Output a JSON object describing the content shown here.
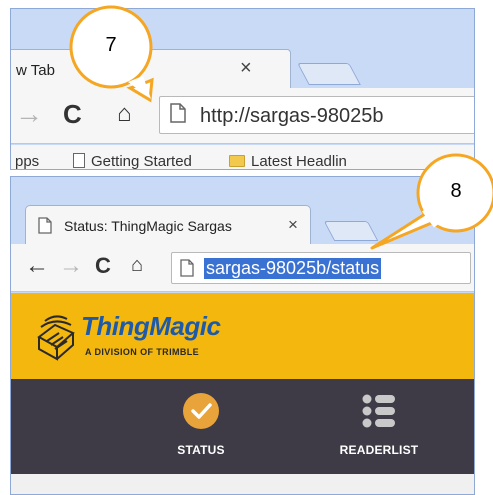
{
  "panel1": {
    "tab": {
      "title": "w Tab",
      "close": "×"
    },
    "toolbar": {
      "forward": "→",
      "reload": "C",
      "home": "⌂"
    },
    "omnibox": {
      "url": "http://sargas-98025b"
    },
    "bookmarks": [
      "pps",
      "Getting Started",
      "Latest Headlin"
    ]
  },
  "panel2": {
    "tab": {
      "title": "Status: ThingMagic Sargas",
      "close": "×"
    },
    "toolbar": {
      "back": "←",
      "forward": "→",
      "reload": "C",
      "home": "⌂"
    },
    "omnibox": {
      "url": "sargas-98025b/status"
    },
    "header": {
      "brand": "ThingMagic",
      "subtitle": "A DIVISION OF TRIMBLE",
      "colors": {
        "bar": "#f3b70e",
        "brand": "#1d5aa9"
      }
    },
    "nav": [
      {
        "label": "STATUS",
        "icon": "checkmark-circle-icon"
      },
      {
        "label": "READERLIST",
        "icon": "list-icon"
      }
    ]
  },
  "callouts": [
    {
      "label": "7"
    },
    {
      "label": "8"
    }
  ],
  "colors": {
    "callout_border": "#f5a623",
    "tabstrip": "#c9daf7",
    "nav_bg": "#3e3b47",
    "highlight": "#3a72d4"
  }
}
